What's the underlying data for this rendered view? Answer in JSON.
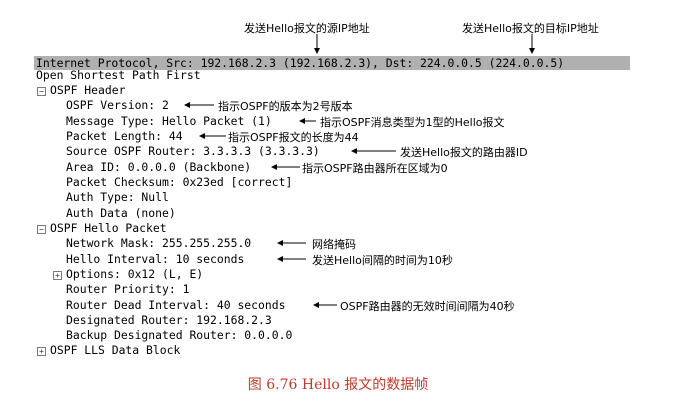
{
  "top_annotations": {
    "src_ip": "发送Hello报文的源IP地址",
    "dst_ip": "发送Hello报文的目标IP地址"
  },
  "ip_line": "Internet Protocol, Src: 192.168.2.3 (192.168.2.3), Dst: 224.0.0.5 (224.0.0.5)",
  "ospf_title": "Open Shortest Path First",
  "header": {
    "toggle": "⊟",
    "label": "OSPF Header",
    "fields": [
      "OSPF Version: 2",
      "Message Type: Hello Packet (1)",
      "Packet Length: 44",
      "Source OSPF Router: 3.3.3.3 (3.3.3.3)",
      "Area ID: 0.0.0.0 (Backbone)",
      "Packet Checksum: 0x23ed [correct]",
      "Auth Type: Null",
      "Auth Data (none)"
    ]
  },
  "hello": {
    "toggle": "⊟",
    "label": "OSPF Hello Packet",
    "fields": [
      "Network Mask: 255.255.255.0",
      "Hello Interval: 10 seconds",
      "Options: 0x12 (L, E)",
      "Router Priority: 1",
      "Router Dead Interval: 40 seconds",
      "Designated Router: 192.168.2.3",
      "Backup Designated Router: 0.0.0.0"
    ],
    "options_toggle": "⊞"
  },
  "lls": {
    "toggle": "⊞",
    "label": "OSPF LLS Data Block"
  },
  "annotations": {
    "version": "指示OSPF的版本为2号版本",
    "msg_type": "指示OSPF消息类型为1型的Hello报文",
    "length": "指示OSPF报文的长度为44",
    "source_router": "发送Hello报文的路由器ID",
    "area": "指示OSPF路由器所在区域为0",
    "mask": "网络掩码",
    "hello_interval": "发送Hello间隔的时间为10秒",
    "dead_interval": "OSPF路由器的无效时间间隔为40秒"
  },
  "caption": "图 6.76 Hello 报文的数据帧"
}
